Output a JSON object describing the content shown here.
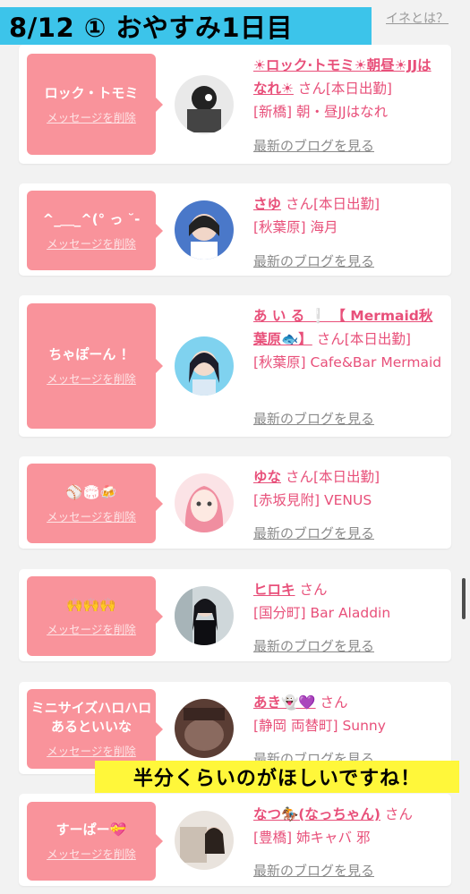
{
  "banner": "8/12 ① おやすみ1日目",
  "top_link": "イネとは？",
  "overlay": "半分くらいのがほしいですね！",
  "delete_label": "メッセージを削除",
  "blog_label": "最新のブログを見る",
  "san": "さん",
  "cards": [
    {
      "msg": "ロック・トモミ",
      "name": "☀ロック·トモミ☀朝昼☀JJはなれ☀",
      "status": "[本日出勤]",
      "shop": "[新橋] 朝・昼JJはなれ"
    },
    {
      "msg": "^_＿_^(° っ ˘-",
      "name": "さゆ",
      "status": "[本日出勤]",
      "shop": "[秋葉原] 海月"
    },
    {
      "msg": "ちゃぽーん ！",
      "name": "あ い る ❕ 【 Mermaid秋葉原🐟】",
      "status": "[本日出勤]",
      "shop": "[秋葉原] Cafe&Bar Mermaid"
    },
    {
      "msg": "⚾🏟🍻",
      "name": "ゆな",
      "status": "[本日出勤]",
      "shop": "[赤坂見附] VENUS"
    },
    {
      "msg": "🙌🙌🙌",
      "name": "ヒロキ",
      "status": "",
      "shop": "[国分町] Bar Aladdin"
    },
    {
      "msg": "ミニサイズハロハロあるといいな",
      "name": "あき👻💜",
      "status": "",
      "shop": "[静岡 両替町] Sunny"
    },
    {
      "msg": "すーぱー💝",
      "name": "なつ🏇(なっちゃん)",
      "status": "",
      "shop": "[豊橋] 姉キャバ 邪"
    }
  ],
  "colors": {
    "bubble": "#f9939b",
    "name": "#e8507a",
    "banner": "#3cc4ea",
    "overlay": "#fff73a"
  }
}
